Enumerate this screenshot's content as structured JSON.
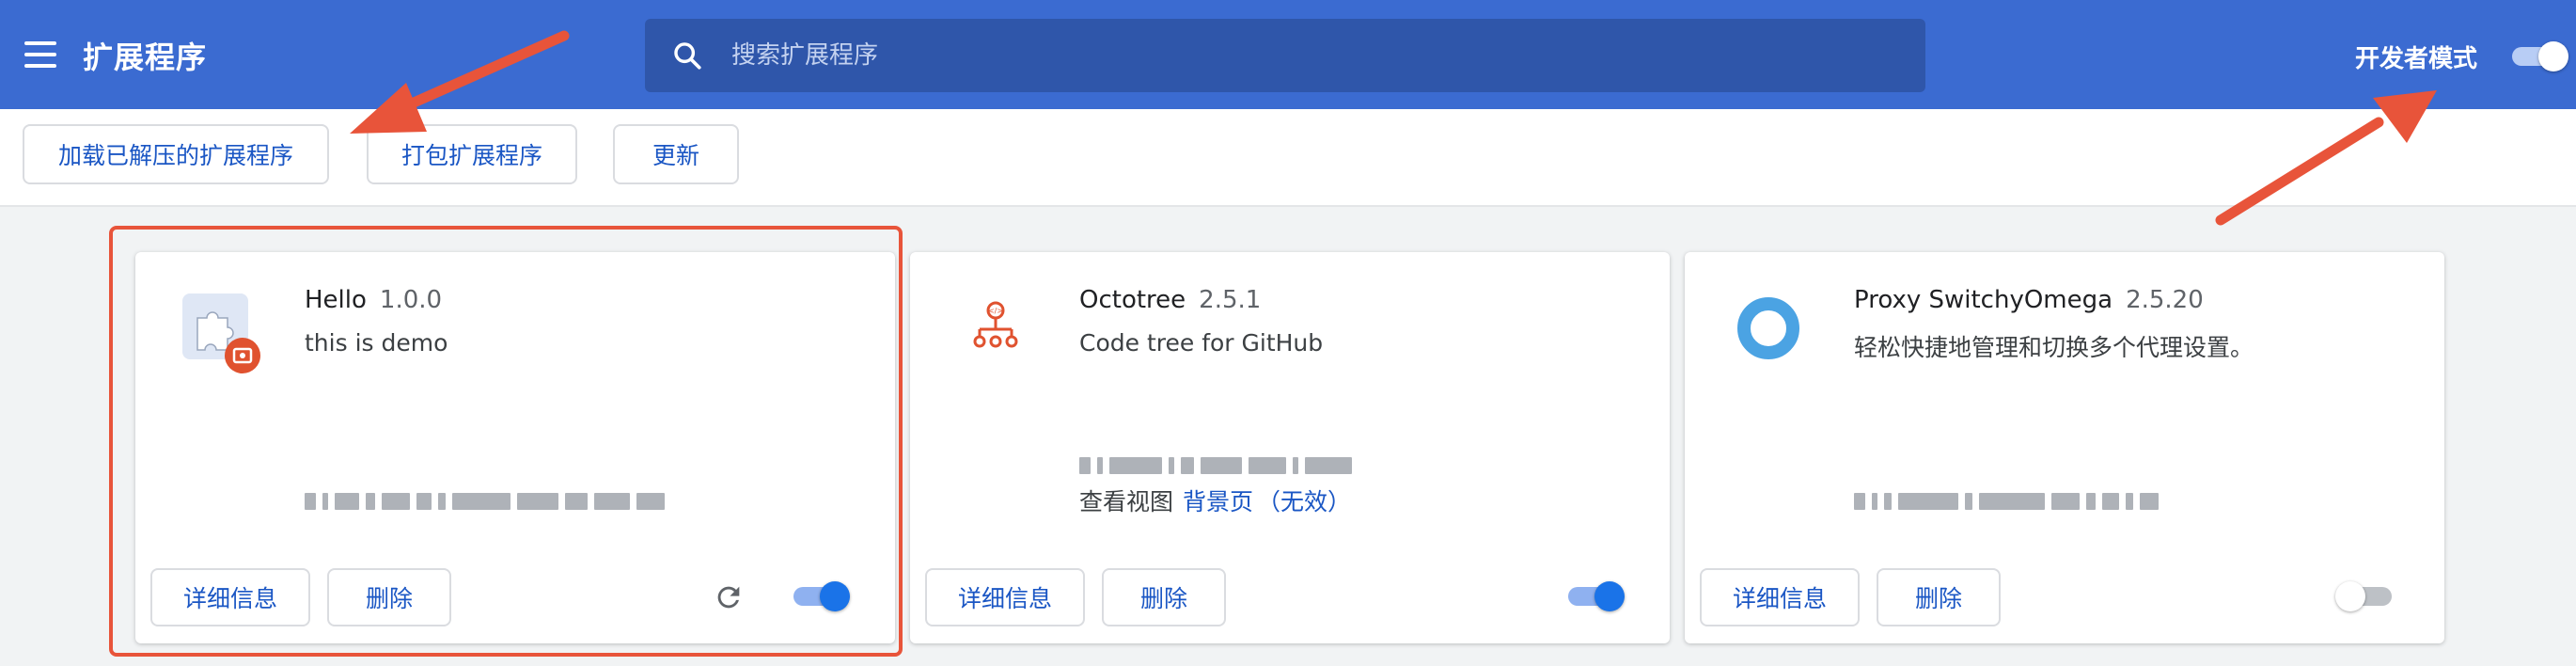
{
  "header": {
    "title": "扩展程序",
    "search_placeholder": "搜索扩展程序",
    "dev_mode_label": "开发者模式",
    "dev_mode_on": true
  },
  "toolbar": {
    "load_unpacked": "加载已解压的扩展程序",
    "pack": "打包扩展程序",
    "update": "更新"
  },
  "extensions": [
    {
      "name": "Hello",
      "version": "1.0.0",
      "description": "this is demo",
      "icon": "puzzle-piece-icon",
      "details_label": "详细信息",
      "remove_label": "删除",
      "enabled": true,
      "has_reload": true
    },
    {
      "name": "Octotree",
      "version": "2.5.1",
      "description": "Code tree for GitHub",
      "icon": "octotree-icon",
      "views_label": "查看视图",
      "views_link": "背景页",
      "views_link_status": "（无效）",
      "details_label": "详细信息",
      "remove_label": "删除",
      "enabled": true
    },
    {
      "name": "Proxy SwitchyOmega",
      "version": "2.5.20",
      "description": "轻松快捷地管理和切换多个代理设置。",
      "icon": "switchyomega-ring-icon",
      "details_label": "详细信息",
      "remove_label": "删除",
      "enabled": false
    }
  ],
  "colors": {
    "header_bg": "#3b6bd1",
    "search_bg": "#2f56aa",
    "accent": "#1a73e8",
    "link": "#1a56c4",
    "annotation": "#e8543a"
  }
}
